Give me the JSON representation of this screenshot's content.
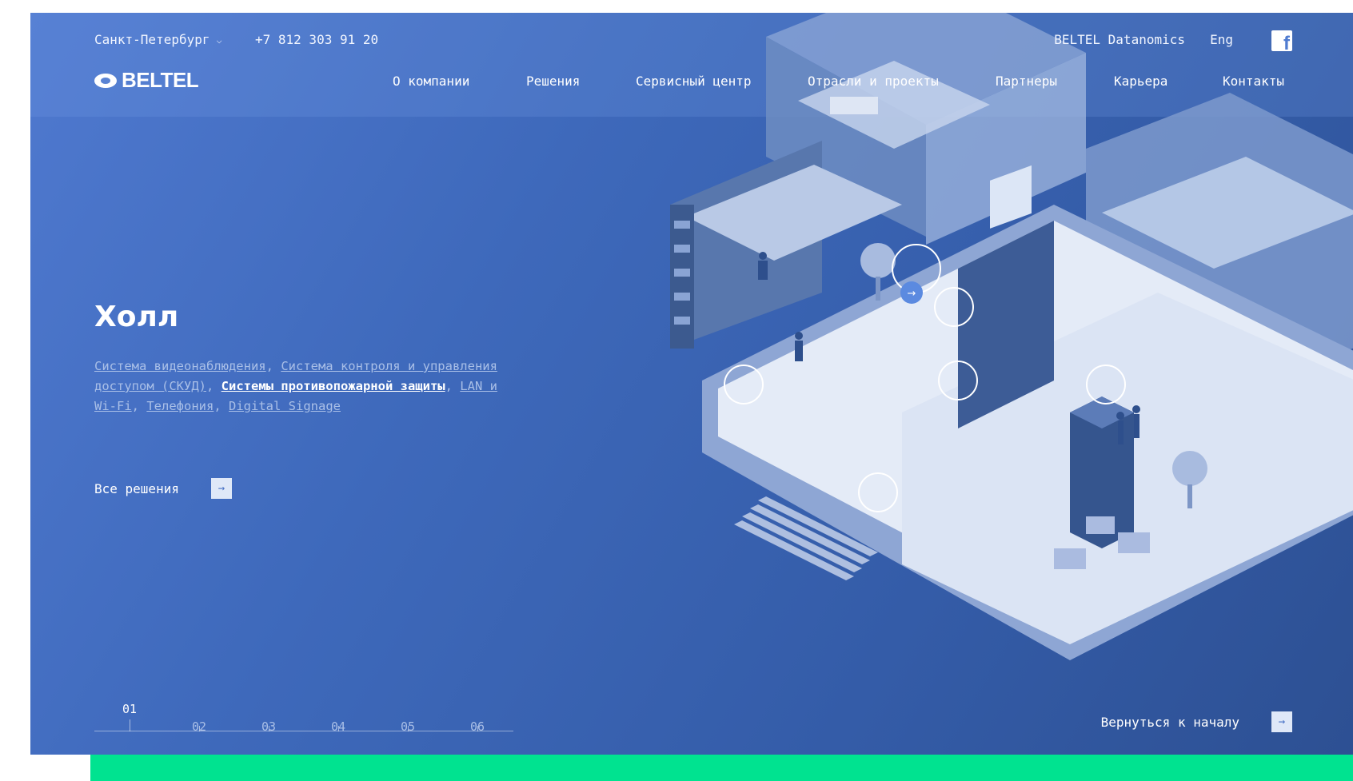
{
  "topbar": {
    "city": "Санкт-Петербург",
    "phone": "+7 812 303 91 20",
    "datanomics": "BELTEL Datanomics",
    "lang": "Eng"
  },
  "logo": {
    "text": "BELTEL"
  },
  "nav": [
    {
      "label": "О компании"
    },
    {
      "label": "Решения"
    },
    {
      "label": "Сервисный центр"
    },
    {
      "label": "Отрасли и проекты"
    },
    {
      "label": "Партнеры"
    },
    {
      "label": "Карьера"
    },
    {
      "label": "Контакты"
    }
  ],
  "hero": {
    "title": "Холл",
    "links": [
      {
        "label": "Система видеонаблюдения",
        "active": false
      },
      {
        "label": "Система контроля и управления доступом (СКУД)",
        "active": false
      },
      {
        "label": "Системы противопожарной защиты",
        "active": true
      },
      {
        "label": "LAN и Wi-Fi",
        "active": false
      },
      {
        "label": "Телефония",
        "active": false
      },
      {
        "label": "Digital Signage",
        "active": false
      }
    ],
    "all_solutions": "Все решения",
    "back_to_start": "Вернуться к началу"
  },
  "steps": [
    "01",
    "02",
    "03",
    "04",
    "05",
    "06"
  ],
  "active_step": "01",
  "colors": {
    "accent_green": "#00e390",
    "hero_blue": "#3e69bb"
  },
  "icons": {
    "chevron": "chevron-down-icon",
    "facebook": "facebook-icon",
    "arrow": "arrow-right-icon"
  }
}
